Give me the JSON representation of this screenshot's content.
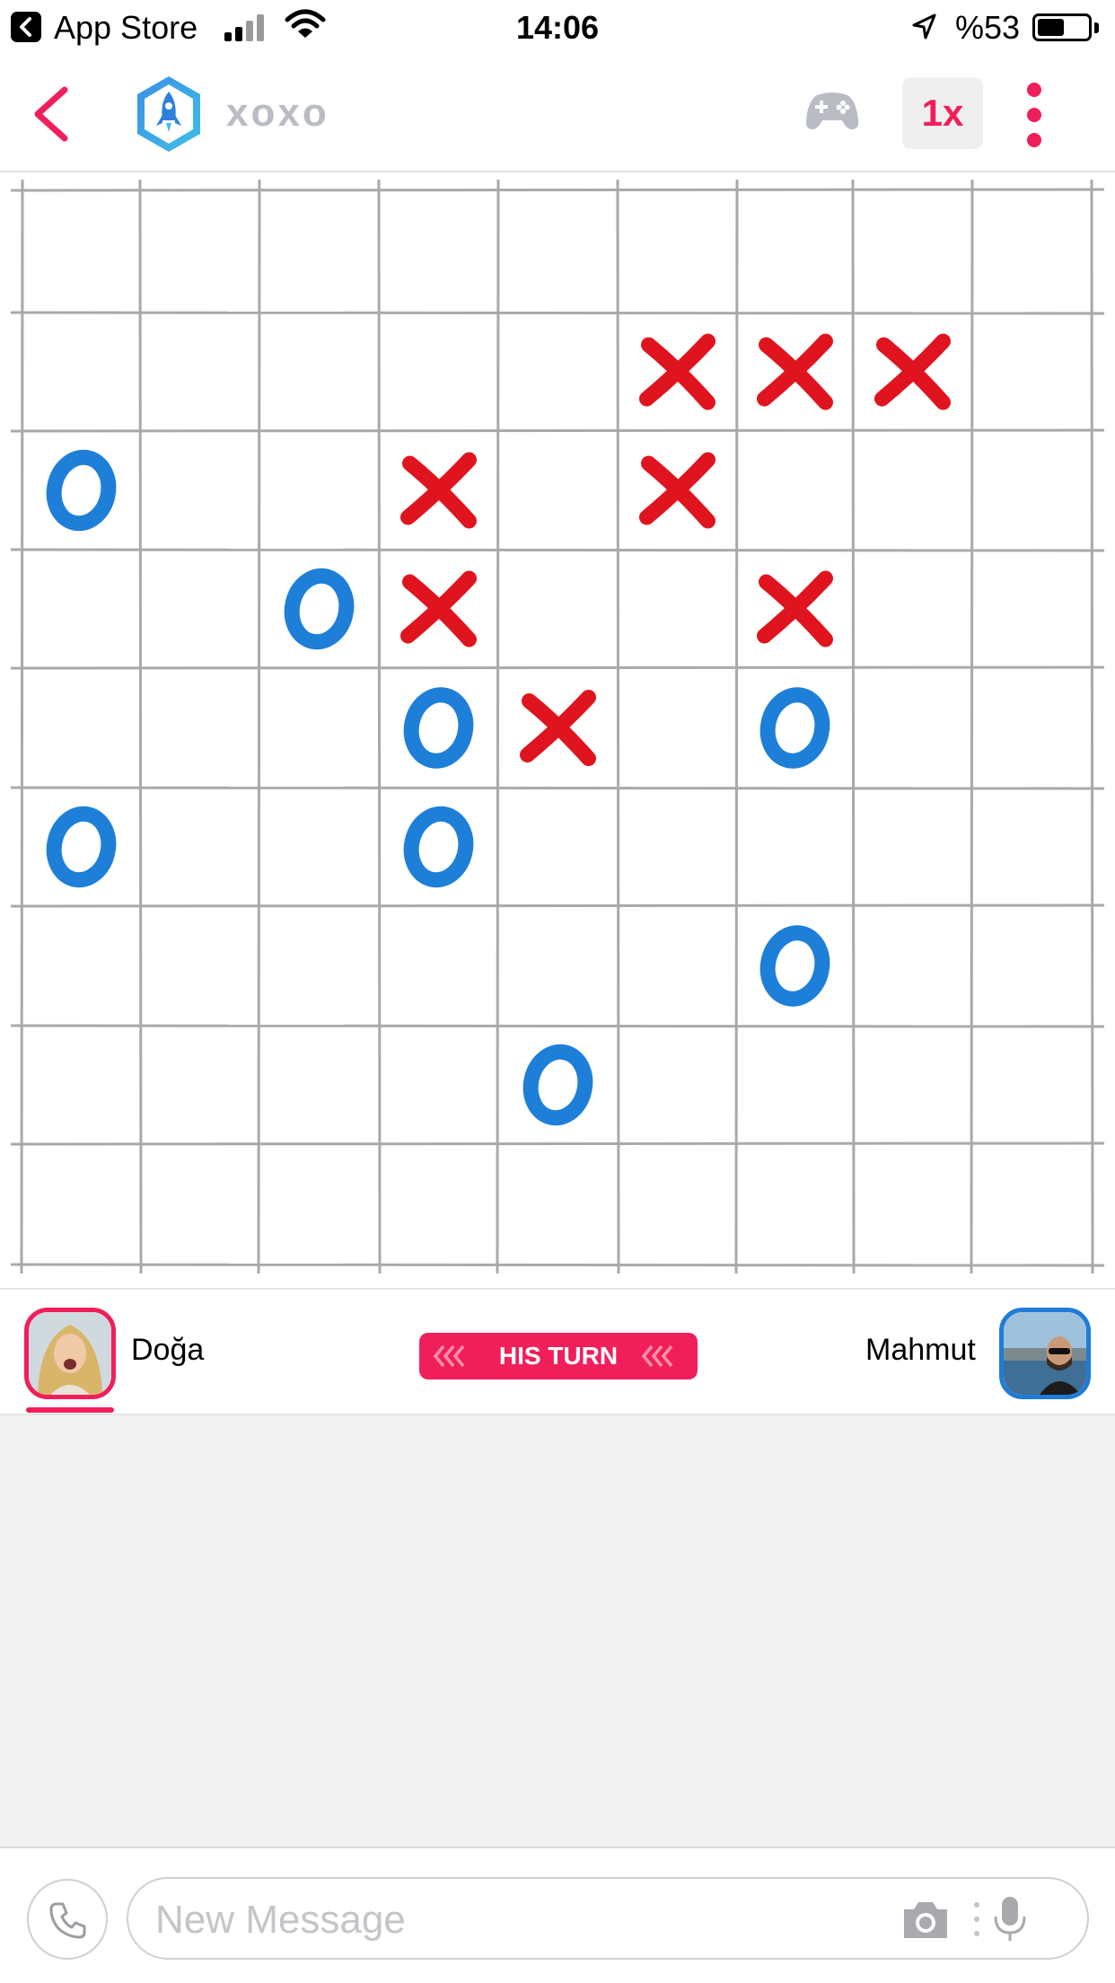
{
  "status_bar": {
    "back_app": "App Store",
    "time": "14:06",
    "battery_text": "%53",
    "battery_level": 0.53
  },
  "header": {
    "app_name": "xoxo",
    "speed_label": "1x",
    "icons": [
      "back-chevron-icon",
      "rocket-logo-icon",
      "gamepad-icon",
      "more-vertical-icon"
    ]
  },
  "board": {
    "cols": 9,
    "rows": 9,
    "moves": [
      {
        "mark": "X",
        "row": 1,
        "col": 5
      },
      {
        "mark": "X",
        "row": 1,
        "col": 6
      },
      {
        "mark": "X",
        "row": 1,
        "col": 7
      },
      {
        "mark": "O",
        "row": 2,
        "col": 0
      },
      {
        "mark": "X",
        "row": 2,
        "col": 3
      },
      {
        "mark": "X",
        "row": 2,
        "col": 5
      },
      {
        "mark": "O",
        "row": 3,
        "col": 2
      },
      {
        "mark": "X",
        "row": 3,
        "col": 3
      },
      {
        "mark": "X",
        "row": 3,
        "col": 6
      },
      {
        "mark": "O",
        "row": 4,
        "col": 3
      },
      {
        "mark": "X",
        "row": 4,
        "col": 4
      },
      {
        "mark": "O",
        "row": 4,
        "col": 6
      },
      {
        "mark": "O",
        "row": 5,
        "col": 0
      },
      {
        "mark": "O",
        "row": 5,
        "col": 3
      },
      {
        "mark": "O",
        "row": 6,
        "col": 6
      },
      {
        "mark": "O",
        "row": 7,
        "col": 4
      }
    ],
    "colors": {
      "x": "#e0141e",
      "o": "#1e7fd9",
      "grid": "#a9a9a9"
    }
  },
  "players": {
    "left": {
      "name": "Doğa",
      "accent": "#f01f5a"
    },
    "right": {
      "name": "Mahmut",
      "accent": "#1e7cd8"
    },
    "turn_label": "HIS TURN"
  },
  "composer": {
    "placeholder": "New Message",
    "icons": [
      "phone-icon",
      "camera-icon",
      "microphone-icon"
    ]
  },
  "colors": {
    "accent": "#f01f5a",
    "muted": "#b9bcc4"
  }
}
